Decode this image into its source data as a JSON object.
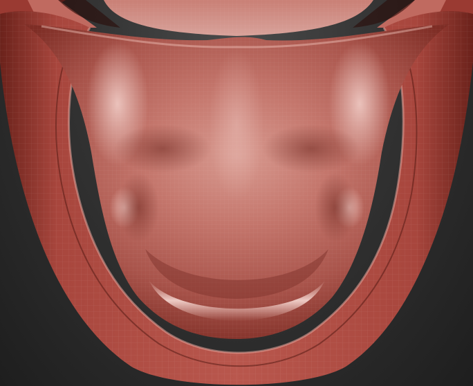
{
  "viewport": {
    "background_color": "#2f2f2f",
    "model_color": "#b3564e",
    "model_highlight_color": "#e9b1a8",
    "model_shadow_color": "#5a1a14",
    "wireframe_visible": true
  }
}
